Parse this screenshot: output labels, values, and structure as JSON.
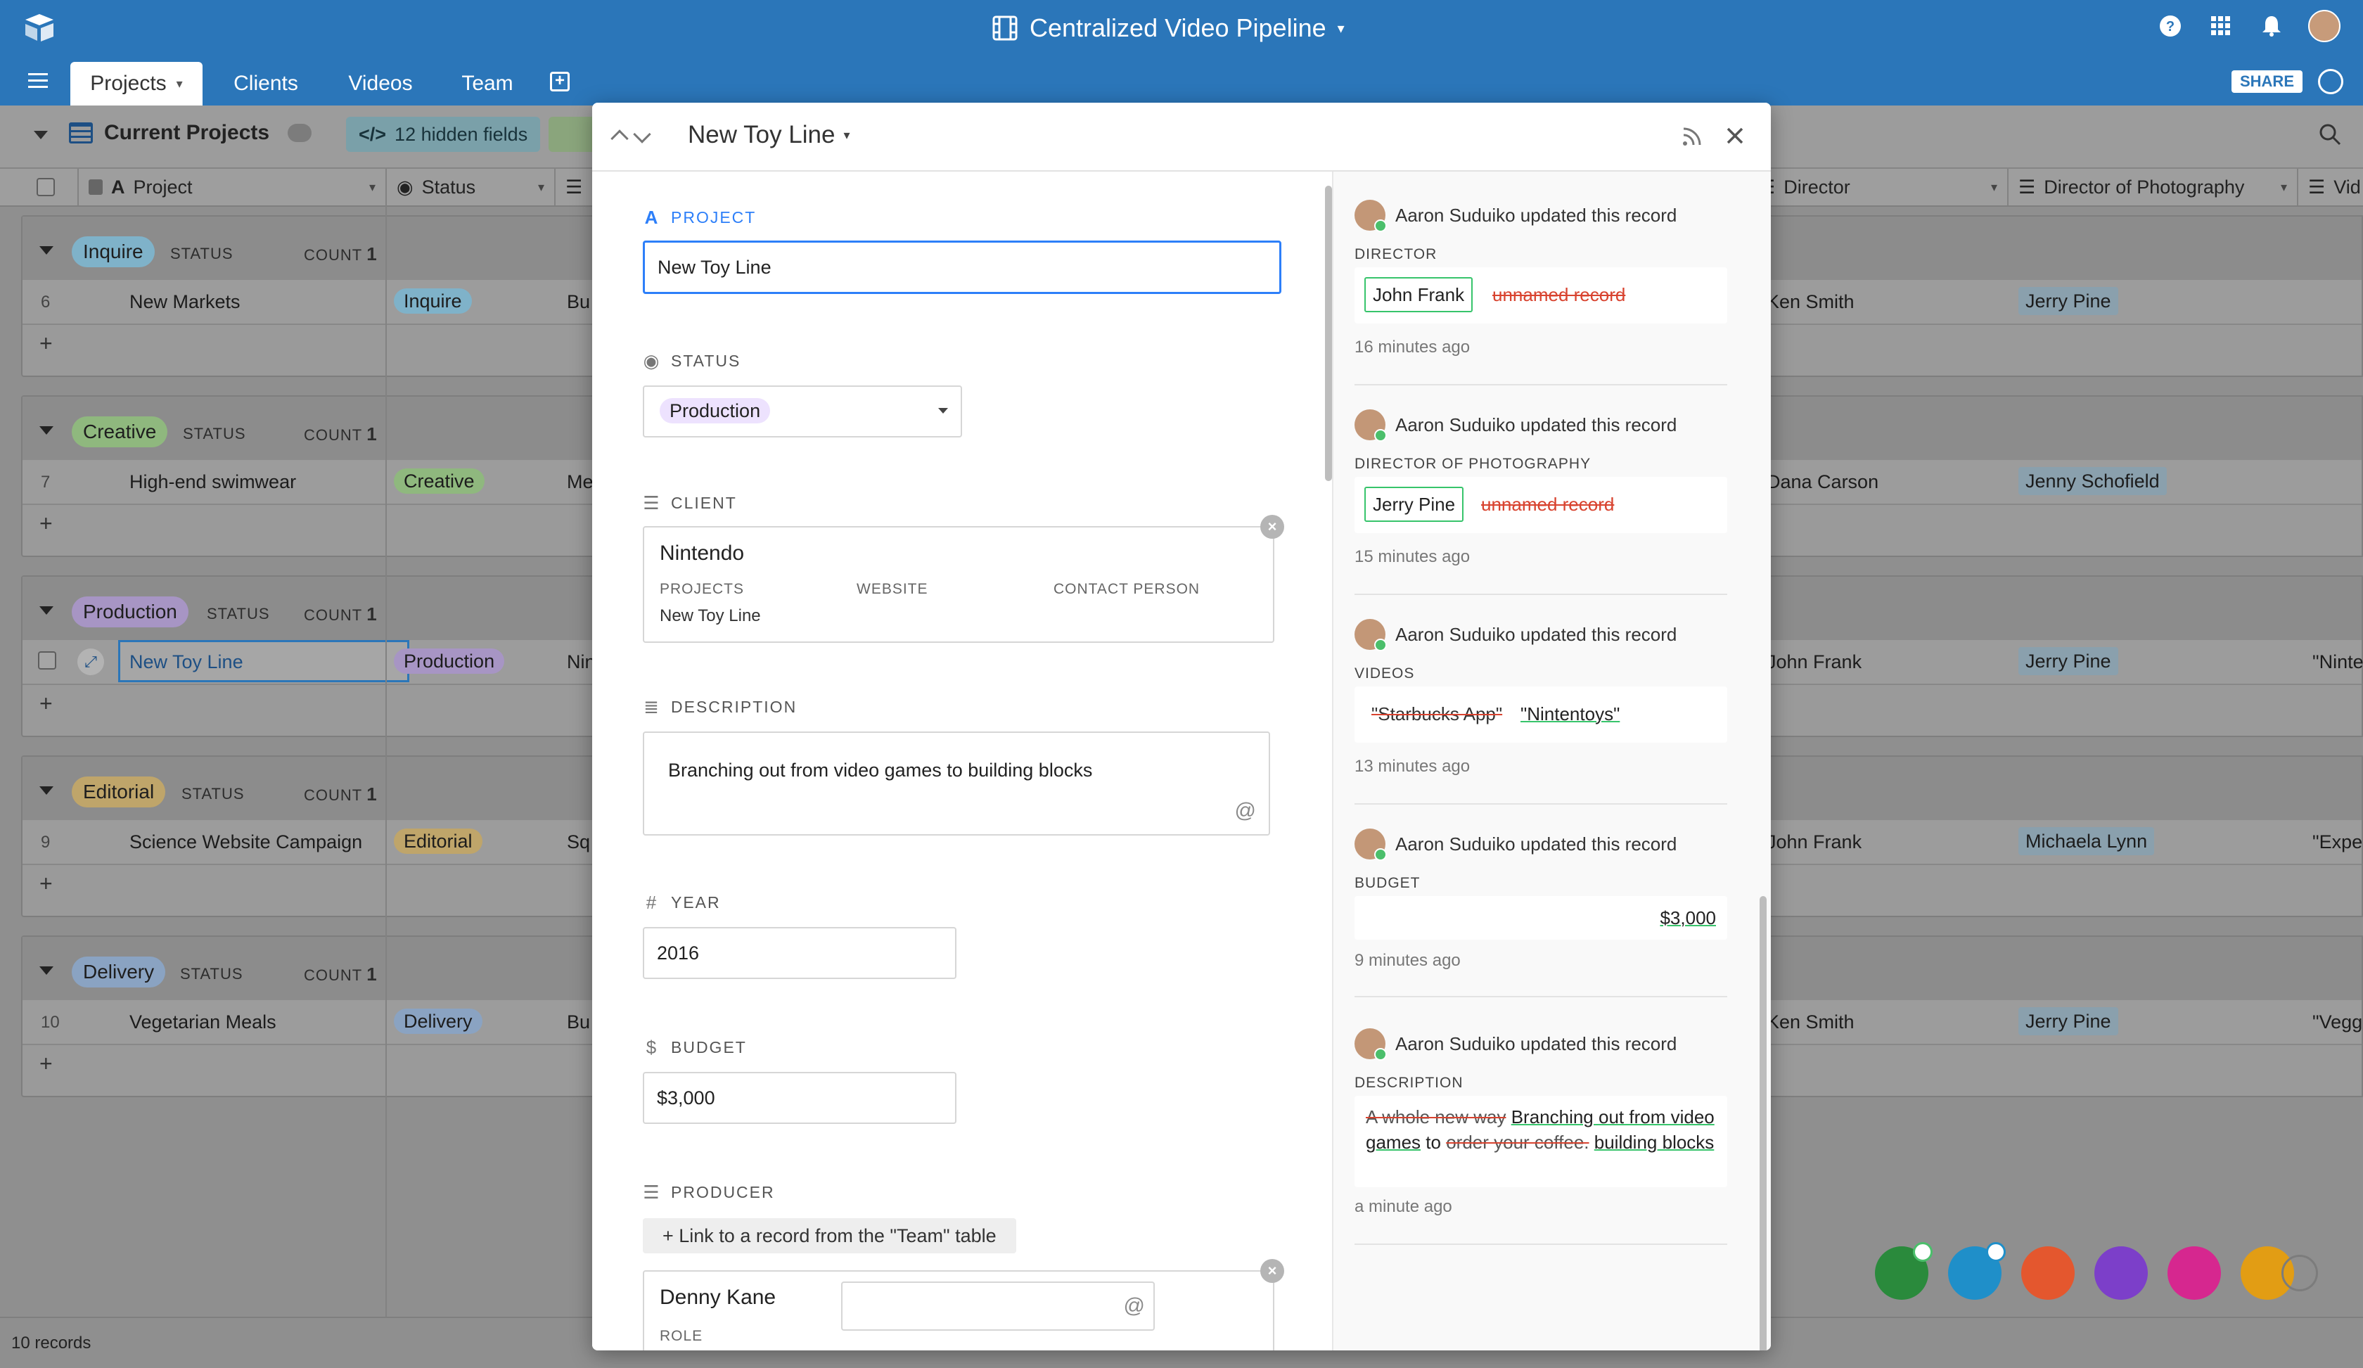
{
  "app": {
    "base_title": "Centralized Video Pipeline",
    "tabs": [
      "Projects",
      "Clients",
      "Videos",
      "Team"
    ],
    "share_label": "SHARE",
    "accent": "#2b76b9"
  },
  "viewbar": {
    "view_name": "Current Projects",
    "hidden_fields": "12 hidden fields"
  },
  "columns": {
    "project": "Project",
    "status": "Status",
    "director": "Director",
    "dop": "Director of Photography",
    "videos": "Vid"
  },
  "groups": [
    {
      "name": "Inquire",
      "status_label": "STATUS",
      "count_label": "COUNT",
      "count": "1",
      "color": "#7fb2c9",
      "row": {
        "num": "6",
        "project": "New Markets",
        "status": "Inquire",
        "cut": "Bu",
        "director": "Ken Smith",
        "dop": "Jerry Pine",
        "videos": ""
      }
    },
    {
      "name": "Creative",
      "status_label": "STATUS",
      "count_label": "COUNT",
      "count": "1",
      "color": "#8fb87e",
      "row": {
        "num": "7",
        "project": "High-end swimwear",
        "status": "Creative",
        "cut": "Me",
        "director": "Dana Carson",
        "dop": "Jenny Schofield",
        "videos": ""
      }
    },
    {
      "name": "Production",
      "status_label": "STATUS",
      "count_label": "COUNT",
      "count": "1",
      "color": "#a795c4",
      "row": {
        "num": "",
        "project": "New Toy Line",
        "status": "Production",
        "cut": "Nin",
        "director": "John Frank",
        "dop": "Jerry Pine",
        "videos": "\"Ninte"
      }
    },
    {
      "name": "Editorial",
      "status_label": "STATUS",
      "count_label": "COUNT",
      "count": "1",
      "color": "#bfa56a",
      "row": {
        "num": "9",
        "project": "Science Website Campaign",
        "status": "Editorial",
        "cut": "Sq",
        "director": "John Frank",
        "dop": "Michaela Lynn",
        "videos": "\"Expe"
      }
    },
    {
      "name": "Delivery",
      "status_label": "STATUS",
      "count_label": "COUNT",
      "count": "1",
      "color": "#8aa3c2",
      "row": {
        "num": "10",
        "project": "Vegetarian Meals",
        "status": "Delivery",
        "cut": "Bu",
        "director": "Ken Smith",
        "dop": "Jerry Pine",
        "videos": "\"Vegg"
      }
    }
  ],
  "footer": {
    "records": "10 records"
  },
  "modal": {
    "title": "New Toy Line",
    "fields": {
      "project_label": "PROJECT",
      "project_value": "New Toy Line",
      "status_label": "STATUS",
      "status_value": "Production",
      "client_label": "CLIENT",
      "client_name": "Nintendo",
      "client_cols": [
        "PROJECTS",
        "WEBSITE",
        "CONTACT PERSON"
      ],
      "client_projects": "New Toy Line",
      "description_label": "DESCRIPTION",
      "description_value": "Branching out from video games to building blocks",
      "year_label": "YEAR",
      "year_value": "2016",
      "budget_label": "BUDGET",
      "budget_value": "$3,000",
      "producer_label": "PRODUCER",
      "producer_link": "+ Link to a record from the \"Team\" table",
      "producer_name": "Denny Kane",
      "producer_sub": "ROLE"
    },
    "activity": [
      {
        "who": "Aaron Suduiko updated this record",
        "field": "DIRECTOR",
        "added": "John Frank",
        "removed": "unnamed record",
        "time": "16 minutes ago"
      },
      {
        "who": "Aaron Suduiko updated this record",
        "field": "DIRECTOR OF PHOTOGRAPHY",
        "added": "Jerry Pine",
        "removed": "unnamed record",
        "time": "15 minutes ago"
      },
      {
        "who": "Aaron Suduiko updated this record",
        "field": "VIDEOS",
        "removed": "\"Starbucks App\"",
        "added": "\"Nintentoys\"",
        "time": "13 minutes ago"
      },
      {
        "who": "Aaron Suduiko updated this record",
        "field": "BUDGET",
        "added": "$3,000",
        "time": "9 minutes ago"
      },
      {
        "who": "Aaron Suduiko updated this record",
        "field": "DESCRIPTION",
        "desc_removed_1": "A whole new way",
        "desc_added_1": "Branching out from video games",
        "desc_to": "to",
        "desc_removed_2": "order your coffee.",
        "desc_added_2": "building blocks",
        "time": "a minute ago"
      }
    ],
    "comment_at": "@"
  }
}
